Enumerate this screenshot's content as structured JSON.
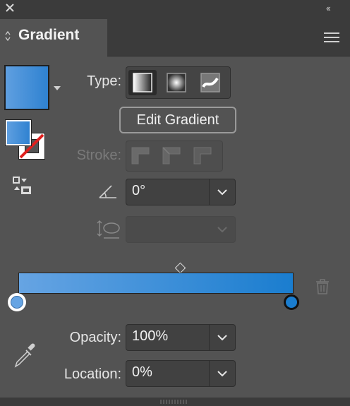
{
  "panel": {
    "title": "Gradient"
  },
  "type_section": {
    "label": "Type:",
    "buttons": [
      "linear-gradient-button",
      "radial-gradient-button",
      "freeform-gradient-button"
    ],
    "selected": "linear"
  },
  "edit_gradient_label": "Edit Gradient",
  "stroke_section": {
    "label": "Stroke:"
  },
  "angle": {
    "value": "0°"
  },
  "aspect": {
    "value": ""
  },
  "gradient": {
    "start_color": "#66a4e3",
    "end_color": "#1a7dcf"
  },
  "opacity": {
    "label": "Opacity:",
    "value": "100%"
  },
  "location": {
    "label": "Location:",
    "value": "0%"
  },
  "colors": {
    "panel_bg": "#535353",
    "header_bg": "#3b3b3b",
    "accent_blue": "#2f82d1"
  }
}
